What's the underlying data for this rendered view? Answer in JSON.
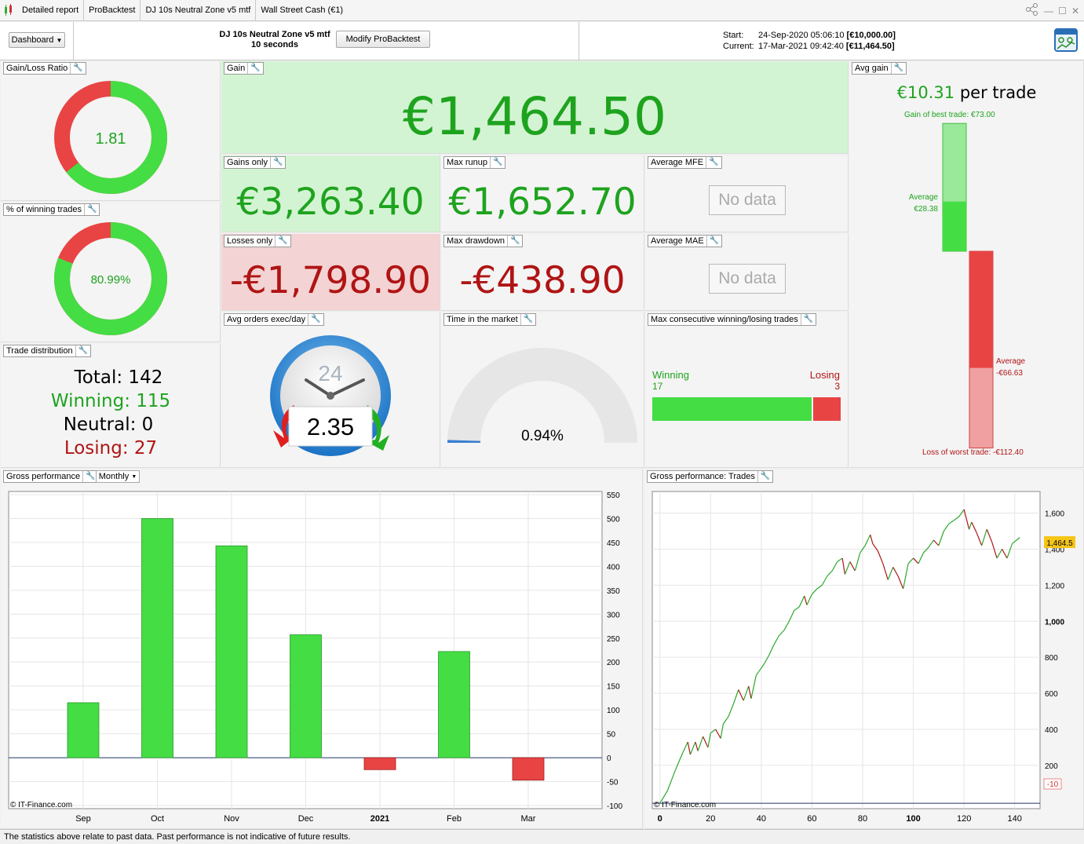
{
  "titlebar": {
    "tabs": [
      "Detailed report",
      "ProBacktest",
      "DJ 10s Neutral Zone v5 mtf",
      "Wall Street Cash (€1)"
    ]
  },
  "header": {
    "dashboard_label": "Dashboard",
    "strategy_name": "DJ 10s Neutral Zone v5 mtf",
    "timeframe": "10 seconds",
    "modify_label": "Modify ProBacktest",
    "start_label": "Start:",
    "start_value": "24-Sep-2020 05:06:10",
    "start_capital": "[€10,000.00]",
    "current_label": "Current:",
    "current_value": "17-Mar-2021 09:42:40",
    "current_capital": "[€11,464.50]"
  },
  "gain_loss": {
    "title": "Gain/Loss Ratio",
    "value": "1.81",
    "ratio_fraction": 0.644
  },
  "winning_pct": {
    "title": "% of winning trades",
    "value": "80.99%",
    "fraction": 0.8099
  },
  "trade_distribution": {
    "title": "Trade distribution",
    "total": "Total: 142",
    "winning": "Winning: 115",
    "neutral": "Neutral: 0",
    "losing": "Losing: 27"
  },
  "gain": {
    "title": "Gain",
    "value": "€1,464.50"
  },
  "gains_only": {
    "title": "Gains only",
    "value": "€3,263.40"
  },
  "max_runup": {
    "title": "Max runup",
    "value": "€1,652.70"
  },
  "average_mfe": {
    "title": "Average MFE",
    "value": "No data"
  },
  "losses_only": {
    "title": "Losses only",
    "value": "-€1,798.90"
  },
  "max_drawdown": {
    "title": "Max drawdown",
    "value": "-€438.90"
  },
  "average_mae": {
    "title": "Average MAE",
    "value": "No data"
  },
  "avg_orders": {
    "title": "Avg orders exec/day",
    "clock_label": "24",
    "value": "2.35"
  },
  "time_in_market": {
    "title": "Time in the market",
    "value": "0.94%",
    "fraction": 0.0094
  },
  "max_consecutive": {
    "title": "Max consecutive winning/losing trades",
    "winning_label": "Winning",
    "winning_value": "17",
    "losing_label": "Losing",
    "losing_value": "3",
    "winning_count": 17,
    "losing_count": 3
  },
  "avg_gain": {
    "title": "Avg gain",
    "per_trade_value": "€10.31",
    "per_trade_suffix": "per trade",
    "best_trade_label": "Gain of best trade: €73.00",
    "avg_gain_label": "Average",
    "avg_gain_value": "€28.38",
    "avg_loss_label": "Average",
    "avg_loss_value": "-€66.63",
    "worst_trade_label": "Loss of worst trade: -€112.40",
    "best_trade": 73.0,
    "avg_win": 28.38,
    "avg_loss": -66.63,
    "worst_trade": -112.4
  },
  "gross_performance": {
    "title": "Gross performance",
    "period_label": "Monthly",
    "watermark": "© IT-Finance.com"
  },
  "gross_performance_trades": {
    "title": "Gross performance: Trades",
    "watermark": "© IT-Finance.com",
    "last_value_label": "1,464.5",
    "low_marker_label": "-10"
  },
  "footer": {
    "disclaimer": "The statistics above relate to past data. Past performance is not indicative of future results."
  },
  "colors": {
    "win_green": "#44dd44",
    "loss_red": "#e84444",
    "text_green": "#1ea31e",
    "text_red": "#b01414",
    "gain_bg": "#d3f4d3",
    "loss_bg": "#f3d3d3"
  },
  "chart_data": [
    {
      "type": "bar",
      "categories": [
        "Sep",
        "Oct",
        "Nov",
        "Dec",
        "2021",
        "Feb",
        "Mar"
      ],
      "values": [
        115,
        500,
        443,
        257,
        -25,
        222,
        -47
      ],
      "ylim": [
        -100,
        550
      ],
      "yticks": [
        -100,
        -50,
        0,
        50,
        100,
        150,
        200,
        250,
        300,
        350,
        400,
        450,
        500,
        550
      ],
      "grid": true
    },
    {
      "type": "line",
      "x": [
        0,
        3,
        6,
        9,
        11,
        12,
        14,
        15,
        17,
        19,
        20,
        22,
        24,
        25,
        27,
        29,
        31,
        33,
        35,
        36,
        38,
        39,
        41,
        43,
        45,
        47,
        49,
        51,
        53,
        55,
        57,
        58,
        60,
        62,
        64,
        66,
        68,
        70,
        72,
        73,
        75,
        77,
        79,
        81,
        83,
        84,
        86,
        88,
        90,
        92,
        94,
        96,
        98,
        100,
        102,
        104,
        106,
        108,
        110,
        112,
        114,
        116,
        118,
        120,
        122,
        123,
        125,
        127,
        129,
        131,
        133,
        135,
        137,
        139,
        142
      ],
      "y": [
        -10,
        60,
        170,
        270,
        330,
        260,
        330,
        280,
        360,
        300,
        380,
        400,
        350,
        430,
        470,
        540,
        620,
        560,
        640,
        570,
        700,
        720,
        760,
        810,
        870,
        920,
        950,
        1000,
        1060,
        1080,
        1140,
        1090,
        1150,
        1180,
        1200,
        1250,
        1280,
        1330,
        1350,
        1260,
        1330,
        1280,
        1380,
        1420,
        1480,
        1430,
        1390,
        1320,
        1230,
        1300,
        1250,
        1180,
        1320,
        1350,
        1320,
        1380,
        1410,
        1450,
        1420,
        1500,
        1540,
        1560,
        1580,
        1620,
        1510,
        1550,
        1490,
        1420,
        1510,
        1440,
        1350,
        1400,
        1350,
        1430,
        1464.5
      ],
      "xticks": [
        0,
        20,
        40,
        60,
        80,
        100,
        120,
        140
      ],
      "yticks": [
        200,
        400,
        600,
        800,
        1000,
        1200,
        1400,
        1600
      ],
      "ylim": [
        -40,
        1720
      ],
      "xlim": [
        -3,
        150
      ],
      "grid": true
    }
  ]
}
